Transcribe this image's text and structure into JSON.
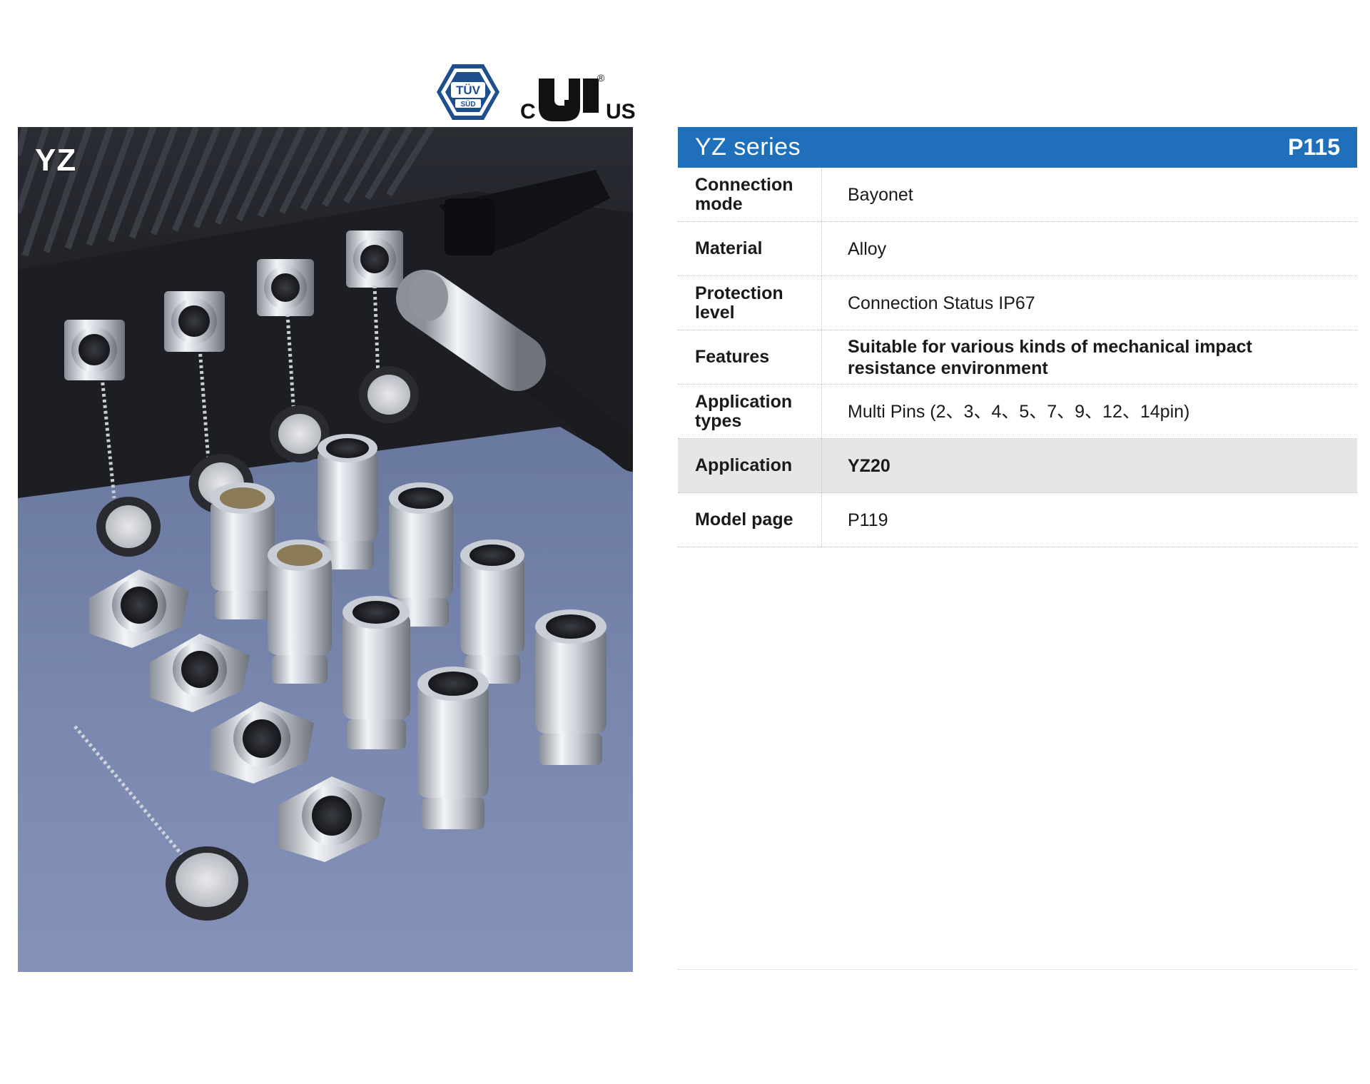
{
  "certifications": {
    "tuv": {
      "top": "TÜV",
      "bottom": "SÜD"
    },
    "ul": {
      "left": "C",
      "right": "US",
      "registered": "®"
    }
  },
  "photo": {
    "label": "YZ"
  },
  "spec": {
    "title": "YZ series",
    "page": "P115",
    "rows": [
      {
        "label": "Connection mode",
        "value": "Bayonet"
      },
      {
        "label": "Material",
        "value": "Alloy"
      },
      {
        "label": "Protection level",
        "value": "Connection Status IP67"
      },
      {
        "label": "Features",
        "value": "Suitable for various kinds of mechanical impact resistance environment"
      },
      {
        "label": "Application types",
        "value": "Multi Pins (2、3、4、5、7、9、12、14pin)"
      },
      {
        "label": "Application",
        "value": "YZ20"
      },
      {
        "label": "Model page",
        "value": "P119"
      }
    ]
  },
  "colors": {
    "header_blue": "#1f6fba",
    "highlight_row": "#e6e6e6"
  }
}
